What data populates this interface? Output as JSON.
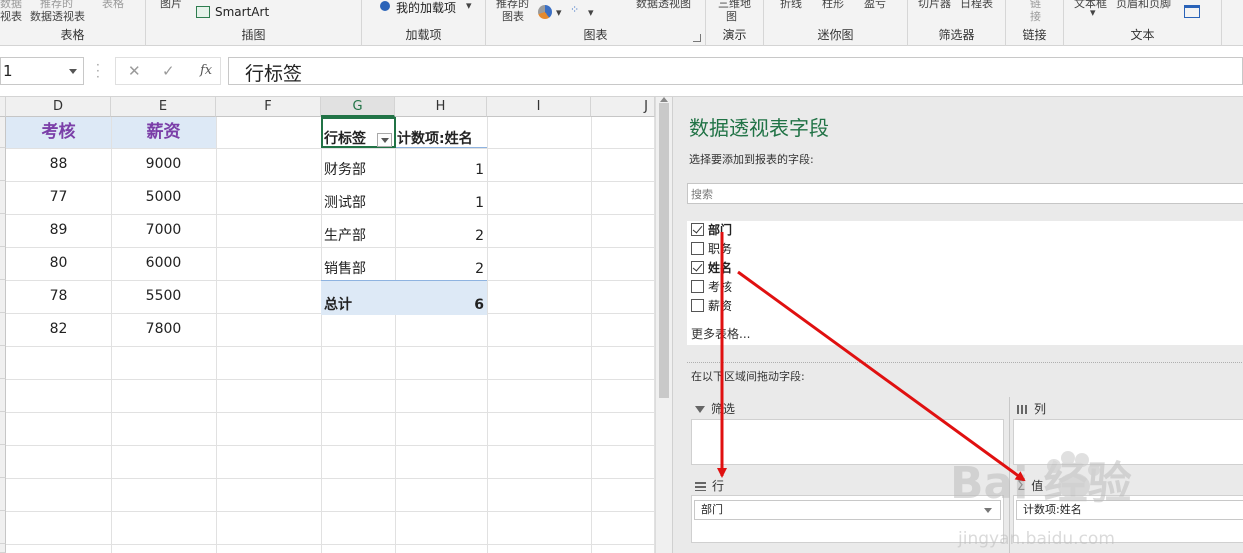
{
  "ribbon": {
    "groups": [
      {
        "label": "表格",
        "frags": [
          "数据",
          "推荐的",
          "表格",
          "视表",
          "数据透视表"
        ]
      },
      {
        "label": "插图",
        "frags": [
          "图片",
          "SmartArt"
        ]
      },
      {
        "label": "加载项",
        "frags": [
          "我的加载项"
        ]
      },
      {
        "label": "图表",
        "frags": [
          "推荐的",
          "图表",
          "数据透视图"
        ]
      },
      {
        "label": "演示",
        "frags": [
          "三维地",
          "图"
        ]
      },
      {
        "label": "迷你图",
        "frags": [
          "折线",
          "柱形",
          "盈亏"
        ]
      },
      {
        "label": "筛选器",
        "frags": [
          "切片器",
          "日程表"
        ]
      },
      {
        "label": "链接",
        "frags": [
          "链",
          "接"
        ]
      },
      {
        "label": "文本",
        "frags": [
          "文本框",
          "页眉和页脚"
        ]
      }
    ]
  },
  "formula_bar": {
    "name_box": "1",
    "cancel_glyph": "✕",
    "enter_glyph": "✓",
    "fx_glyph": "fx",
    "formula": "行标签"
  },
  "sheet": {
    "columns": [
      "D",
      "E",
      "F",
      "G",
      "H",
      "I",
      "J"
    ],
    "headers": {
      "d": "考核",
      "e": "薪资"
    },
    "rows": [
      {
        "d": "88",
        "e": "9000"
      },
      {
        "d": "77",
        "e": "5000"
      },
      {
        "d": "89",
        "e": "7000"
      },
      {
        "d": "80",
        "e": "6000"
      },
      {
        "d": "78",
        "e": "5500"
      },
      {
        "d": "82",
        "e": "7800"
      }
    ],
    "pivot": {
      "row_label_header": "行标签",
      "value_header": "计数项:姓名",
      "rows": [
        {
          "label": "财务部",
          "count": "1"
        },
        {
          "label": "测试部",
          "count": "1"
        },
        {
          "label": "生产部",
          "count": "2"
        },
        {
          "label": "销售部",
          "count": "2"
        }
      ],
      "total_label": "总计",
      "total_value": "6"
    }
  },
  "pane": {
    "title": "数据透视表字段",
    "subtitle": "选择要添加到报表的字段:",
    "search_placeholder": "搜索",
    "fields": [
      {
        "name": "部门",
        "checked": true
      },
      {
        "name": "职务",
        "checked": false
      },
      {
        "name": "姓名",
        "checked": true
      },
      {
        "name": "考核",
        "checked": false
      },
      {
        "name": "薪资",
        "checked": false
      }
    ],
    "more_tables": "更多表格...",
    "drag_hint": "在以下区域间拖动字段:",
    "areas": {
      "filters": "筛选",
      "columns": "列",
      "rows": "行",
      "values": "值"
    },
    "row_item": "部门",
    "value_item": "计数项:姓名"
  },
  "watermark": {
    "text": "Bai 经验",
    "url": "jingyan.baidu.com"
  },
  "colors": {
    "accent": "#217346",
    "header_purple": "#7b3fa8",
    "band_blue": "#dde9f6",
    "arrow_red": "#e01010"
  }
}
